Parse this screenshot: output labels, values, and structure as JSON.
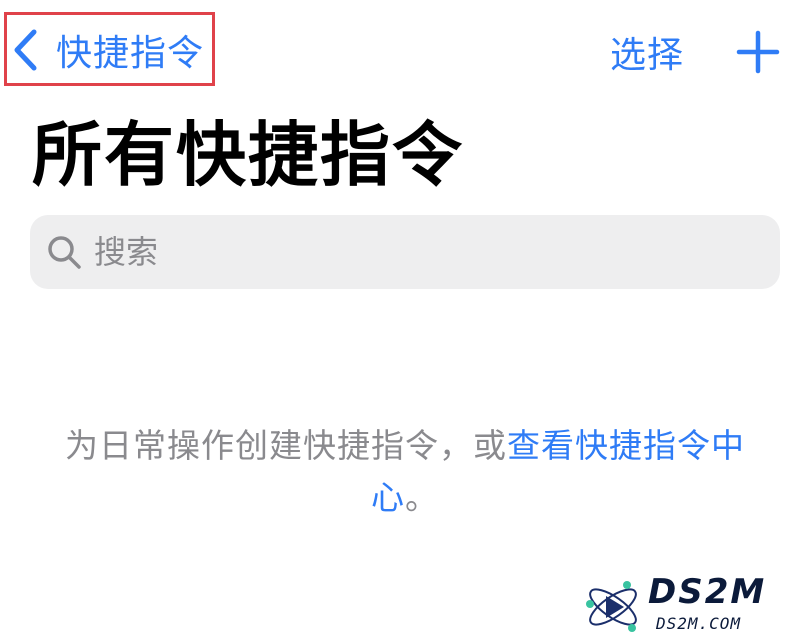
{
  "nav": {
    "back_label": "快捷指令",
    "select_label": "选择",
    "add_icon": "plus-icon",
    "back_icon": "chevron-left-icon"
  },
  "page": {
    "title": "所有快捷指令"
  },
  "search": {
    "placeholder": "搜索",
    "value": "",
    "icon": "search-icon"
  },
  "empty_state": {
    "text_prefix": "为日常操作创建快捷指令，或",
    "link_text": "查看快捷指令中心",
    "text_suffix": "。"
  },
  "watermark": {
    "title": "DS2M",
    "subtitle": "DS2M.COM"
  },
  "colors": {
    "accent": "#2f7cf6",
    "secondary_text": "#8a8a8e",
    "search_bg": "#eeeeef",
    "highlight_border": "#e0424a"
  }
}
